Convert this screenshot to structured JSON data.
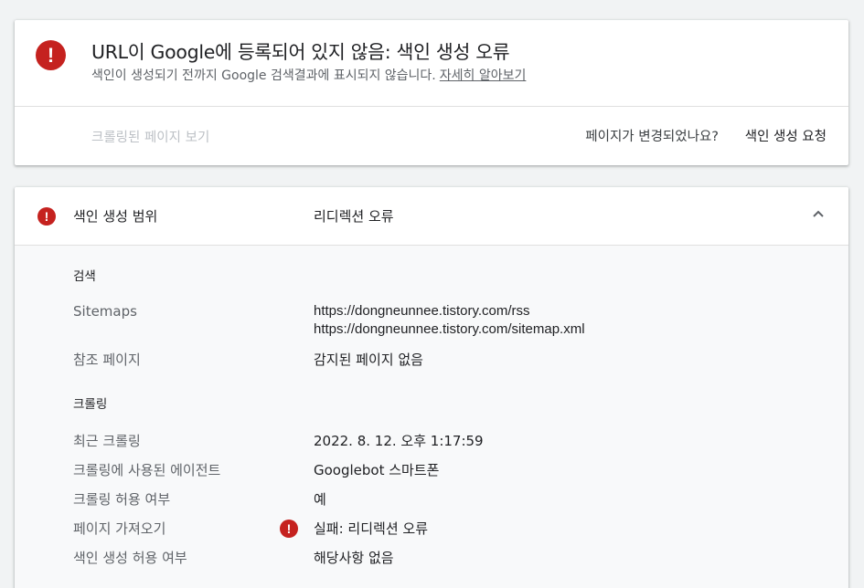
{
  "colors": {
    "error": "#c5221f",
    "text_primary": "#202124",
    "text_secondary": "#5f6368",
    "disabled": "#bdc1c6"
  },
  "status": {
    "icon": "error-icon",
    "title": "URL이 Google에 등록되어 있지 않음: 색인 생성 오류",
    "description": "색인이 생성되기 전까지 Google 검색결과에 표시되지 않습니다.",
    "learn_more": "자세히 알아보기",
    "crawled_page_link": "크롤링된 페이지 보기",
    "changed_question": "페이지가 변경되었나요?",
    "request_index": "색인 생성 요청"
  },
  "coverage": {
    "icon": "error-icon",
    "label": "색인 생성 범위",
    "value": "리디렉션 오류",
    "toggle_icon": "chevron-up-icon",
    "discovery": {
      "title": "검색",
      "sitemaps_label": "Sitemaps",
      "sitemaps": [
        "https://dongneunnee.tistory.com/rss",
        "https://dongneunnee.tistory.com/sitemap.xml"
      ],
      "referring_label": "참조 페이지",
      "referring_value": "감지된 페이지 없음"
    },
    "crawl": {
      "title": "크롤링",
      "last_crawl_label": "최근 크롤링",
      "last_crawl_value": "2022. 8. 12. 오후 1:17:59",
      "agent_label": "크롤링에 사용된 에이전트",
      "agent_value": "Googlebot 스마트폰",
      "allowed_label": "크롤링 허용 여부",
      "allowed_value": "예",
      "fetch_label": "페이지 가져오기",
      "fetch_icon": "error-icon",
      "fetch_value": "실패: 리디렉션 오류",
      "indexing_allowed_label": "색인 생성 허용 여부",
      "indexing_allowed_value": "해당사항 없음"
    }
  }
}
